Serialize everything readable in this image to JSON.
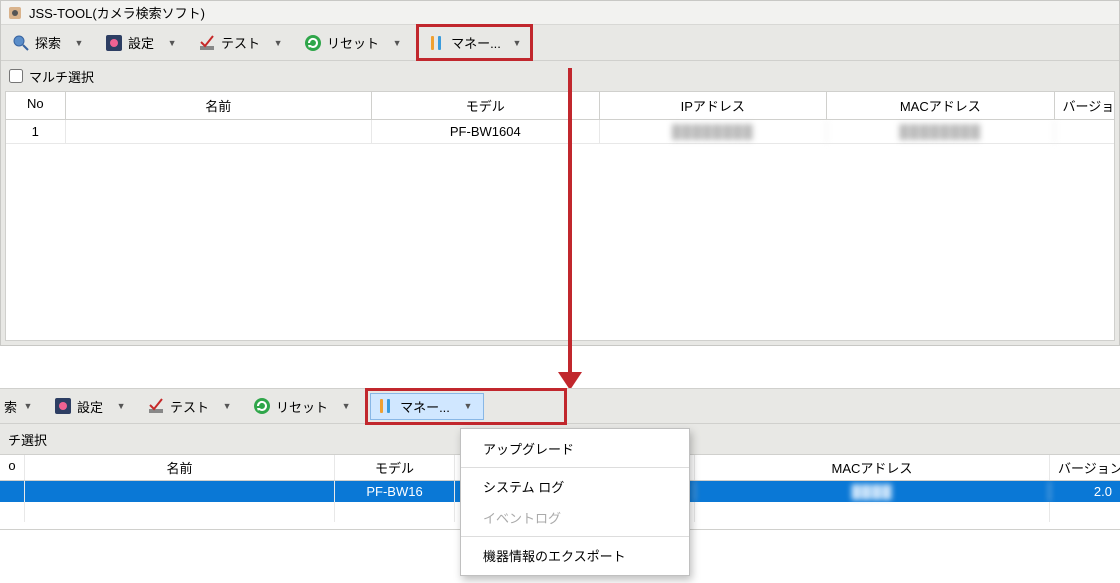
{
  "app": {
    "title": "JSS-TOOL(カメラ検索ソフト)"
  },
  "toolbar": {
    "search": "探索",
    "settings": "設定",
    "test": "テスト",
    "reset": "リセット",
    "manage": "マネー..."
  },
  "filter": {
    "multi": "マルチ選択"
  },
  "grid": {
    "headers": {
      "no": "No",
      "name": "名前",
      "model": "モデル",
      "ip": "IPアドレス",
      "mac": "MACアドレス",
      "ver": "バージョン"
    },
    "rows": [
      {
        "no": "1",
        "name": "",
        "model": "PF-BW1604",
        "ip": "████████",
        "mac": "████████",
        "ver": ""
      }
    ]
  },
  "grid2": {
    "rows": [
      {
        "no": "",
        "name": "",
        "model": "PF-BW16",
        "mac_blur": "████",
        "ver": "2.0"
      }
    ]
  },
  "dropdown": {
    "upgrade": "アップグレード",
    "syslog": "システム ログ",
    "eventlog": "イベントログ",
    "export": "機器情報のエクスポート"
  },
  "secondary_label": {
    "search": "索",
    "multi": "チ選択",
    "no_short": "o"
  }
}
